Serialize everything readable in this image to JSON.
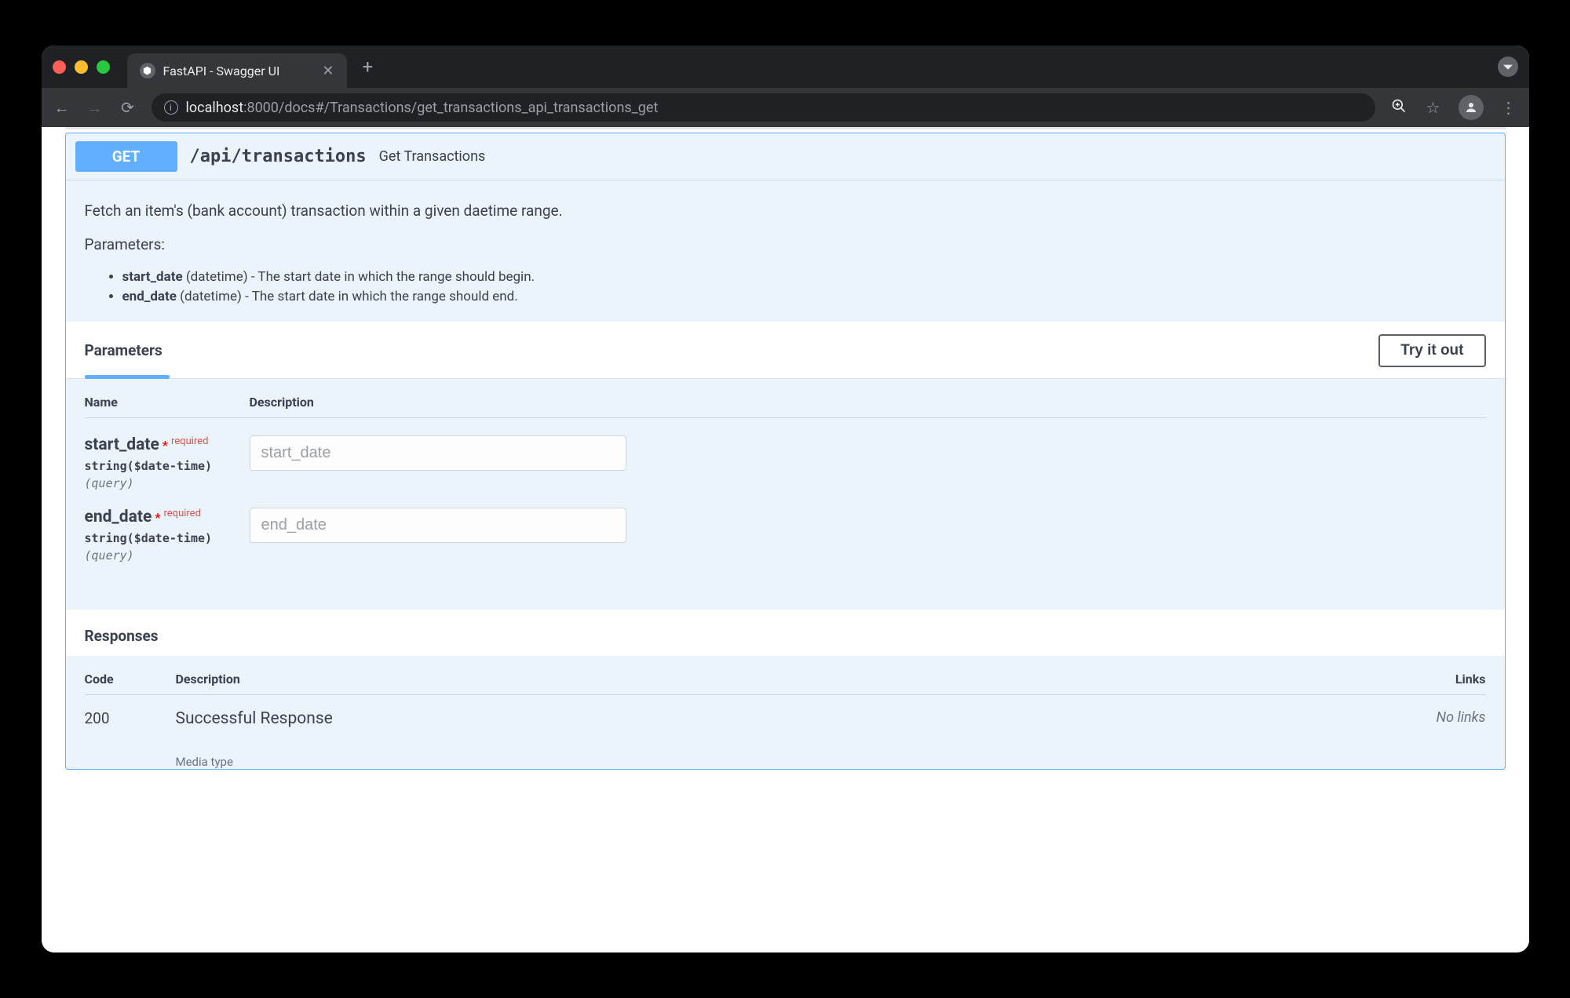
{
  "browser": {
    "tab_title": "FastAPI - Swagger UI",
    "url_host": "localhost",
    "url_rest": ":8000/docs#/Transactions/get_transactions_api_transactions_get"
  },
  "endpoint": {
    "method": "GET",
    "path": "/api/transactions",
    "summary": "Get Transactions",
    "description_intro": "Fetch an item's (bank account) transaction within a given daetime range.",
    "description_params_label": "Parameters:",
    "doc_params": [
      {
        "name": "start_date",
        "rest": " (datetime) - The start date in which the range should begin."
      },
      {
        "name": "end_date",
        "rest": " (datetime) - The start date in which the range should end."
      }
    ]
  },
  "parameters": {
    "section_title": "Parameters",
    "try_label": "Try it out",
    "headers": {
      "name": "Name",
      "description": "Description"
    },
    "rows": [
      {
        "name": "start_date",
        "required_label": "required",
        "type": "string($date-time)",
        "loc": "(query)",
        "placeholder": "start_date"
      },
      {
        "name": "end_date",
        "required_label": "required",
        "type": "string($date-time)",
        "loc": "(query)",
        "placeholder": "end_date"
      }
    ]
  },
  "responses": {
    "section_title": "Responses",
    "headers": {
      "code": "Code",
      "description": "Description",
      "links": "Links"
    },
    "rows": [
      {
        "code": "200",
        "description": "Successful Response",
        "links": "No links",
        "media_type_label": "Media type"
      }
    ]
  }
}
